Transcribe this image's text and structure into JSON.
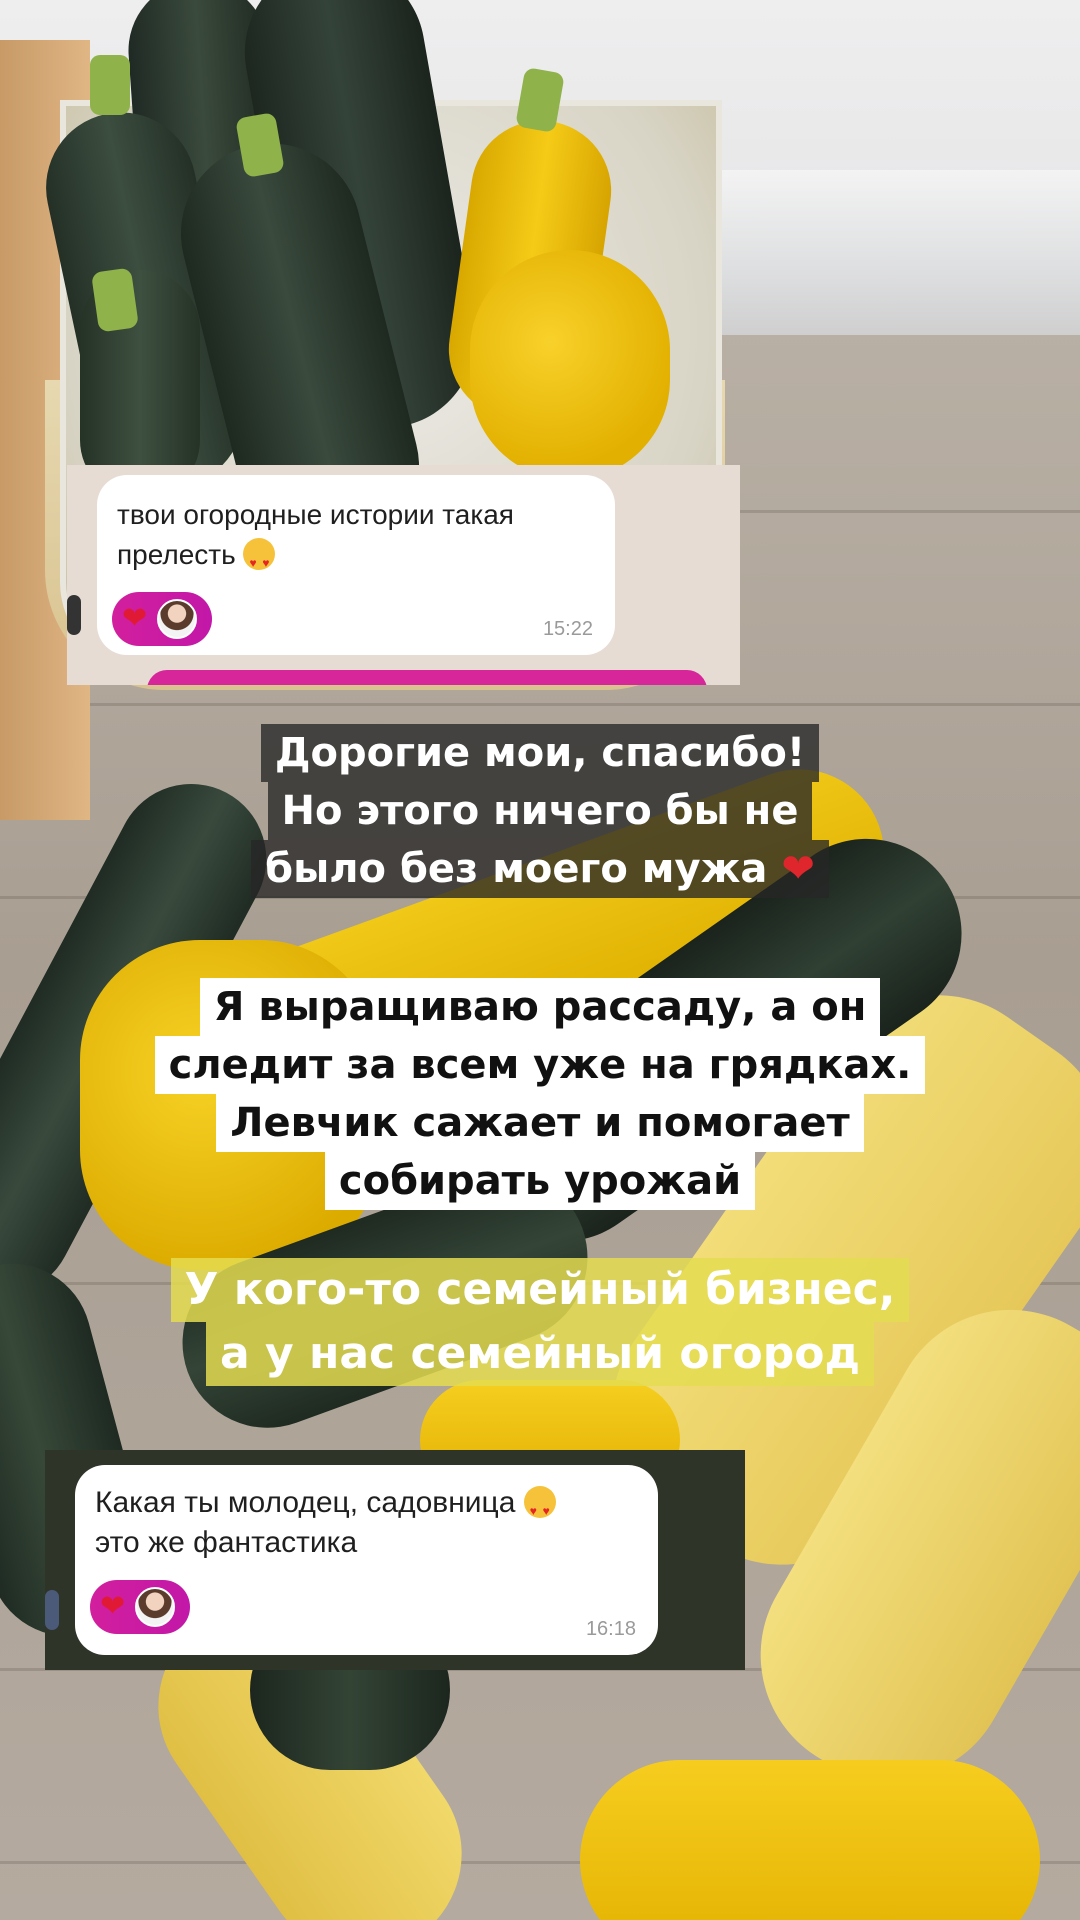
{
  "chat_one": {
    "message": "твои огородные истории такая прелесть",
    "time": "15:22",
    "reaction_heart": "❤"
  },
  "caption_one": {
    "lines": [
      "Дорогие мои, спасибо!",
      "Но этого ничего бы не",
      "было без моего мужа"
    ],
    "heart": "❤"
  },
  "caption_two": {
    "lines": [
      "Я выращиваю рассаду, а он",
      "следит за всем уже на грядках.",
      "Левчик сажает и помогает",
      "собирать урожай"
    ]
  },
  "caption_three": {
    "lines": [
      "У кого-то семейный бизнес,",
      "а у нас семейный огород"
    ]
  },
  "chat_two": {
    "message_line1": "Какая ты молодец, садовница",
    "message_line2": "это же фантастика",
    "time": "16:18",
    "reaction_heart": "❤"
  },
  "colors": {
    "reaction_pill": "#d21f9d",
    "caption_highlight": "#e4dc50"
  }
}
